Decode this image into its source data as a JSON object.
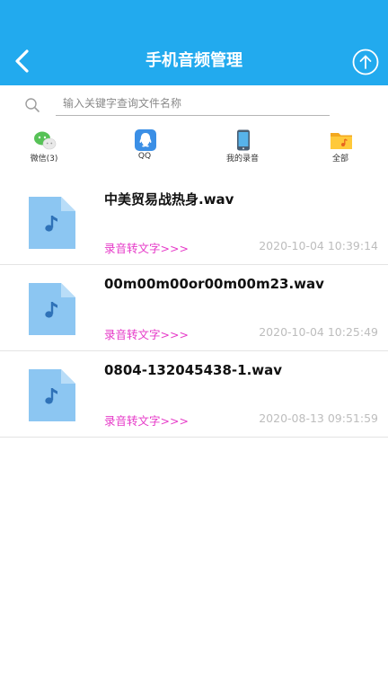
{
  "header": {
    "title": "手机音频管理",
    "back_icon": "chevron-left-icon",
    "upload_icon": "upload-circle-icon",
    "bg_color": "#22aaee"
  },
  "search": {
    "placeholder": "输入关键字查询文件名称",
    "value": ""
  },
  "sources": [
    {
      "label": "微信(3)",
      "icon": "wechat-icon"
    },
    {
      "label": "QQ",
      "icon": "qq-icon"
    },
    {
      "label": "我的录音",
      "icon": "phone-icon"
    },
    {
      "label": "全部",
      "icon": "folder-icon"
    }
  ],
  "files": [
    {
      "name": "中美贸易战热身.wav",
      "action": "录音转文字>>>",
      "time": "2020-10-04 10:39:14"
    },
    {
      "name": "00m00m00or00m00m23.wav",
      "action": "录音转文字>>>",
      "time": "2020-10-04 10:25:49"
    },
    {
      "name": "0804-132045438-1.wav",
      "action": "录音转文字>>>",
      "time": "2020-08-13 09:51:59"
    }
  ],
  "colors": {
    "accent": "#22aaee",
    "action": "#e639c8",
    "timestamp": "#bdbdbd"
  }
}
